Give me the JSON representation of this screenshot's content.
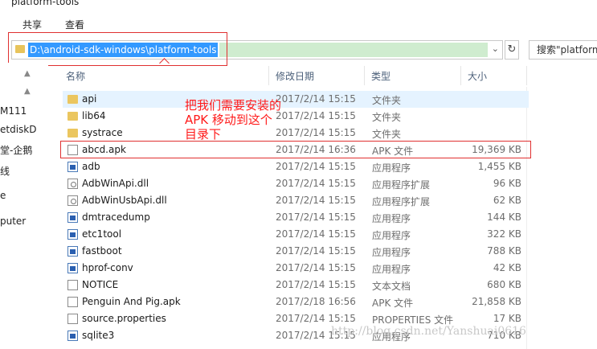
{
  "window": {
    "title": "platform-tools"
  },
  "ribbon": {
    "tabs": [
      "共享",
      "查看"
    ]
  },
  "address": {
    "path": "D:\\android-sdk-windows\\platform-tools"
  },
  "search": {
    "placeholder": "搜索\"platform"
  },
  "nav": {
    "items": [
      "M111",
      "etdiskD",
      "堂-企鹅",
      "线",
      "e",
      "puter"
    ]
  },
  "columns": {
    "name": "名称",
    "date": "修改日期",
    "type": "类型",
    "size": "大小"
  },
  "files": [
    {
      "name": "api",
      "date": "2017/2/14 15:15",
      "type": "文件夹",
      "size": "",
      "icon": "folder-icon"
    },
    {
      "name": "lib64",
      "date": "2017/2/14 15:15",
      "type": "文件夹",
      "size": "",
      "icon": "folder-icon"
    },
    {
      "name": "systrace",
      "date": "2017/2/14 15:15",
      "type": "文件夹",
      "size": "",
      "icon": "folder-icon"
    },
    {
      "name": "abcd.apk",
      "date": "2017/2/14 16:36",
      "type": "APK 文件",
      "size": "19,369 KB",
      "icon": "file-icon"
    },
    {
      "name": "adb",
      "date": "2017/2/14 15:15",
      "type": "应用程序",
      "size": "1,455 KB",
      "icon": "exe-icon"
    },
    {
      "name": "AdbWinApi.dll",
      "date": "2017/2/14 15:15",
      "type": "应用程序扩展",
      "size": "96 KB",
      "icon": "dll-icon"
    },
    {
      "name": "AdbWinUsbApi.dll",
      "date": "2017/2/14 15:15",
      "type": "应用程序扩展",
      "size": "62 KB",
      "icon": "dll-icon"
    },
    {
      "name": "dmtracedump",
      "date": "2017/2/14 15:15",
      "type": "应用程序",
      "size": "144 KB",
      "icon": "exe-icon"
    },
    {
      "name": "etc1tool",
      "date": "2017/2/14 15:15",
      "type": "应用程序",
      "size": "322 KB",
      "icon": "exe-icon"
    },
    {
      "name": "fastboot",
      "date": "2017/2/14 15:15",
      "type": "应用程序",
      "size": "788 KB",
      "icon": "exe-icon"
    },
    {
      "name": "hprof-conv",
      "date": "2017/2/14 15:15",
      "type": "应用程序",
      "size": "42 KB",
      "icon": "exe-icon"
    },
    {
      "name": "NOTICE",
      "date": "2017/2/14 15:15",
      "type": "文本文档",
      "size": "680 KB",
      "icon": "file-icon"
    },
    {
      "name": "Penguin And Pig.apk",
      "date": "2017/2/18 16:56",
      "type": "APK 文件",
      "size": "21,858 KB",
      "icon": "file-icon"
    },
    {
      "name": "source.properties",
      "date": "2017/2/14 15:15",
      "type": "PROPERTIES 文件",
      "size": "17 KB",
      "icon": "file-icon"
    },
    {
      "name": "sqlite3",
      "date": "2017/2/14 15:15",
      "type": "应用程序",
      "size": "710 KB",
      "icon": "exe-icon"
    }
  ],
  "annotation": {
    "lines": [
      "把我们需要安装的",
      "APK 移动到这个",
      "目录下"
    ]
  },
  "watermark": "http://blog.csdn.net/Yanshuai0616",
  "colors": {
    "selection": "#3399ff",
    "highlight_row": "#e5f3ff",
    "annotation": "#ff1a1a"
  }
}
